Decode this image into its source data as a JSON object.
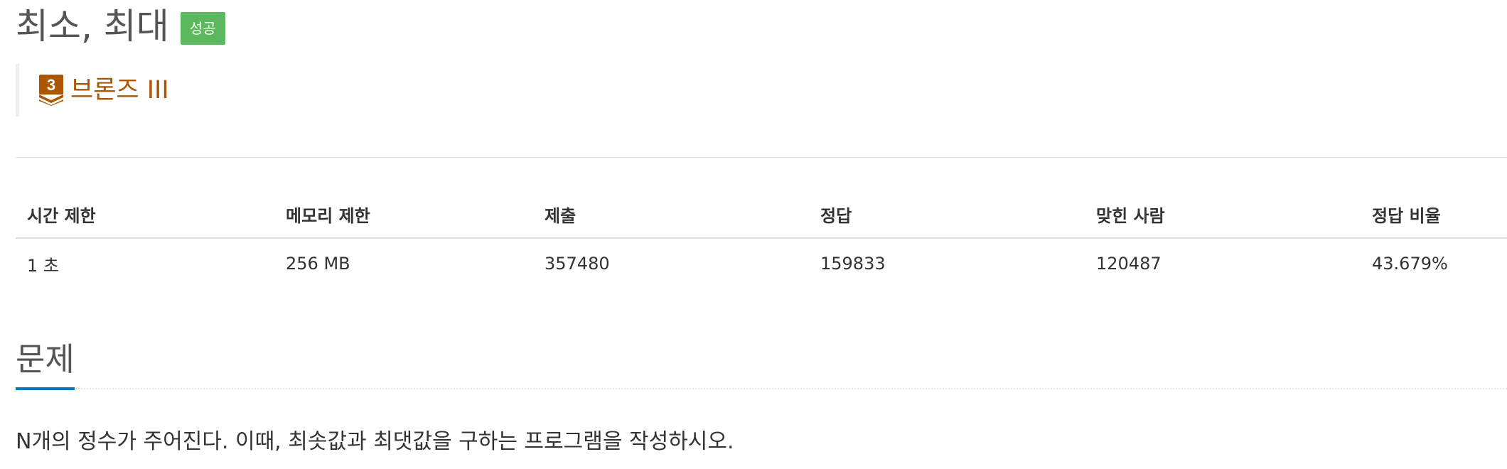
{
  "problem": {
    "title": "최소, 최대",
    "status_badge": "성공",
    "tier": {
      "icon": "bronze-tier-badge-icon",
      "level_number": "3",
      "label": "브론즈 III",
      "color": "#ad5600"
    }
  },
  "info_table": {
    "headers": [
      "시간 제한",
      "메모리 제한",
      "제출",
      "정답",
      "맞힌 사람",
      "정답 비율"
    ],
    "row": [
      "1 초",
      "256 MB",
      "357480",
      "159833",
      "120487",
      "43.679%"
    ]
  },
  "section": {
    "title": "문제",
    "description": "N개의 정수가 주어진다. 이때, 최솟값과 최댓값을 구하는 프로그램을 작성하시오."
  },
  "colors": {
    "success_badge": "#5cb85c",
    "section_underline": "#0076c0",
    "bronze": "#ad5600"
  }
}
